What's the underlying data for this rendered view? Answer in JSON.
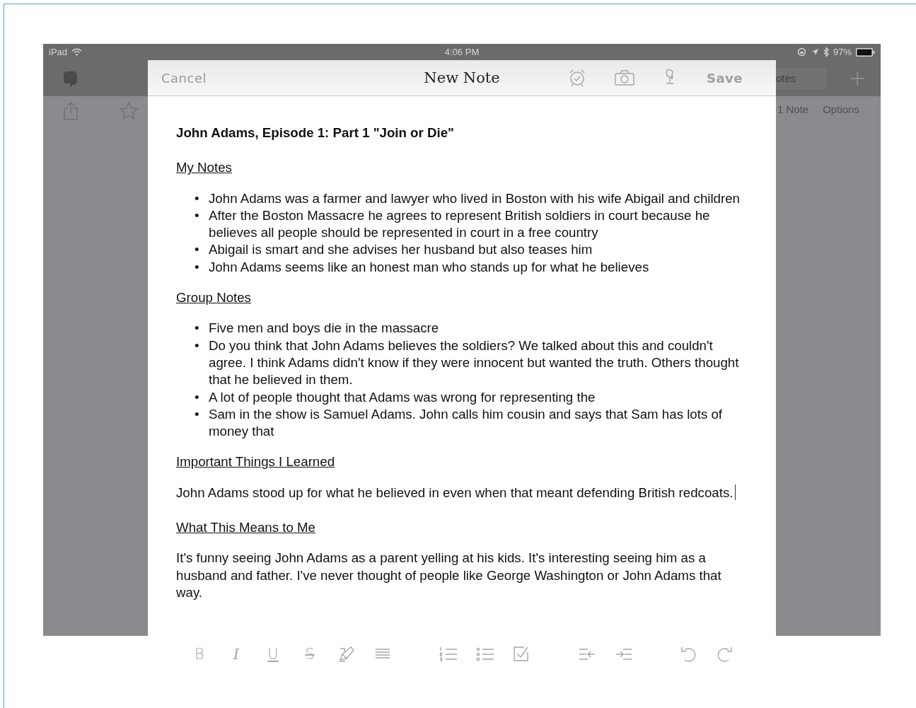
{
  "status_bar": {
    "device": "iPad",
    "time": "4:06 PM",
    "battery_text": "97%"
  },
  "background_app": {
    "search_text": "otes",
    "note_count": "1 Note",
    "options": "Options"
  },
  "note_editor": {
    "title": "New Note",
    "cancel": "Cancel",
    "save": "Save",
    "note_title": "John Adams, Episode 1: Part 1 \"Join or Die\"",
    "sections": [
      {
        "heading": "My Notes",
        "kind": "bullets",
        "marker": "•",
        "items": [
          "John Adams was a farmer and lawyer who lived in Boston with his wife Abigail and children",
          "After the Boston Massacre he agrees to represent British soldiers in court because he believes all people should be represented in court in a free country",
          "Abigail is smart and she advises her husband but also teases him",
          "John Adams seems like an honest man who stands up for what he believes"
        ]
      },
      {
        "heading": "Group Notes",
        "kind": "bullets",
        "marker": "•",
        "items": [
          "Five men and boys die in the massacre",
          "Do you think that John Adams believes the soldiers? We talked about this and couldn't agree. I think Adams didn't know if they were innocent but wanted the truth. Others thought that he believed in them.",
          "A lot of people thought that Adams was wrong for representing the",
          "Sam in the show is Samuel Adams. John calls him cousin and says that Sam has lots of money that"
        ]
      },
      {
        "heading": "Important Things I Learned",
        "kind": "paragraph",
        "text": "John Adams stood up for what he believed in even when that meant defending British redcoats.",
        "cursor": true
      },
      {
        "heading": "What This Means to Me",
        "kind": "paragraph",
        "text": "It's funny seeing John Adams as a parent yelling at his kids. It's interesting seeing him as a husband and father. I've never thought of people like George Washington or John Adams that way.",
        "cursor": false
      }
    ]
  },
  "format_toolbar": [
    [
      {
        "kind": "bold",
        "label": "B"
      },
      {
        "kind": "italic",
        "label": "I"
      },
      {
        "kind": "underline",
        "label": "U"
      },
      {
        "kind": "strike",
        "label": "S"
      },
      {
        "kind": "highlight"
      },
      {
        "kind": "align"
      }
    ],
    [
      {
        "kind": "numbered"
      },
      {
        "kind": "bulleted"
      },
      {
        "kind": "checkbox"
      }
    ],
    [
      {
        "kind": "outdent"
      },
      {
        "kind": "indent"
      }
    ],
    [
      {
        "kind": "undo"
      },
      {
        "kind": "redo"
      }
    ]
  ]
}
